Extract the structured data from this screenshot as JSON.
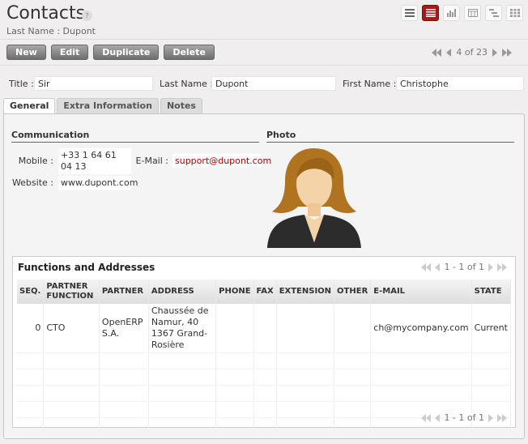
{
  "header": {
    "title": "Contacts",
    "help": "?",
    "subtitle": "Last Name : Dupont"
  },
  "views": [
    {
      "icon": "list-view-icon",
      "active": false
    },
    {
      "icon": "form-view-icon",
      "active": true
    },
    {
      "icon": "graph-view-icon",
      "active": false
    },
    {
      "icon": "calendar-view-icon",
      "active": false
    },
    {
      "icon": "gantt-view-icon",
      "active": false
    },
    {
      "icon": "kanban-view-icon",
      "active": false
    }
  ],
  "toolbar": {
    "new_label": "New",
    "edit_label": "Edit",
    "duplicate_label": "Duplicate",
    "delete_label": "Delete"
  },
  "pager": {
    "text": "4 of 23"
  },
  "fields": {
    "title_label": "Title :",
    "title_value": "Sir",
    "last_name_label": "Last Name :",
    "last_name_value": "Dupont",
    "first_name_label": "First Name :",
    "first_name_value": "Christophe"
  },
  "tabs": [
    "General",
    "Extra Information",
    "Notes"
  ],
  "communication": {
    "heading": "Communication",
    "mobile_label": "Mobile :",
    "mobile_value": "+33 1 64 61 04 13",
    "email_label": "E-Mail :",
    "email_value": "support@dupont.com",
    "website_label": "Website :",
    "website_value": "www.dupont.com"
  },
  "photo": {
    "heading": "Photo"
  },
  "functions": {
    "heading": "Functions and Addresses",
    "pager": "1 - 1 of 1",
    "columns": [
      "SEQ.",
      "PARTNER FUNCTION",
      "PARTNER",
      "ADDRESS",
      "PHONE",
      "FAX",
      "EXTENSION",
      "OTHER",
      "E-MAIL",
      "STATE"
    ],
    "rows": [
      {
        "seq": "0",
        "function": "CTO",
        "partner": "OpenERP S.A.",
        "address": "Chaussée de Namur, 40 1367 Grand-Rosière",
        "phone": "",
        "fax": "",
        "extension": "",
        "other": "",
        "email": "ch@mycompany.com",
        "state": "Current"
      }
    ]
  },
  "colors": {
    "accent": "#a31c1c",
    "link": "#aa0000",
    "background": "#f0eeee"
  }
}
